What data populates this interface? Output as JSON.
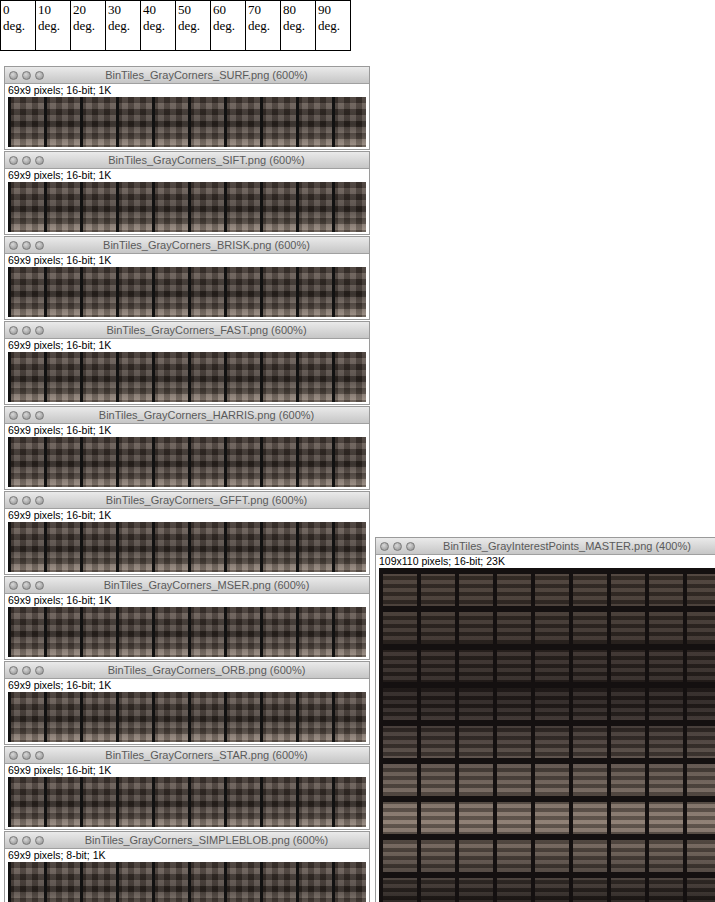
{
  "degrees": [
    {
      "label": "0 deg."
    },
    {
      "label": "10 deg."
    },
    {
      "label": "20 deg."
    },
    {
      "label": "30 deg."
    },
    {
      "label": "40 deg."
    },
    {
      "label": "50 deg."
    },
    {
      "label": "60 deg."
    },
    {
      "label": "70 deg."
    },
    {
      "label": "80 deg."
    },
    {
      "label": "90 deg."
    }
  ],
  "windows": [
    {
      "title": "BinTiles_GrayCorners_SURF.png (600%)",
      "info": "69x9 pixels; 16-bit; 1K"
    },
    {
      "title": "BinTiles_GrayCorners_SIFT.png (600%)",
      "info": "69x9 pixels; 16-bit; 1K"
    },
    {
      "title": "BinTiles_GrayCorners_BRISK.png (600%)",
      "info": "69x9 pixels; 16-bit; 1K"
    },
    {
      "title": "BinTiles_GrayCorners_FAST.png (600%)",
      "info": "69x9 pixels; 16-bit; 1K"
    },
    {
      "title": "BinTiles_GrayCorners_HARRIS.png (600%)",
      "info": "69x9 pixels; 16-bit; 1K"
    },
    {
      "title": "BinTiles_GrayCorners_GFFT.png (600%)",
      "info": "69x9 pixels; 16-bit; 1K"
    },
    {
      "title": "BinTiles_GrayCorners_MSER.png (600%)",
      "info": "69x9 pixels; 16-bit; 1K"
    },
    {
      "title": "BinTiles_GrayCorners_ORB.png (600%)",
      "info": "69x9 pixels; 16-bit; 1K"
    },
    {
      "title": "BinTiles_GrayCorners_STAR.png (600%)",
      "info": "69x9 pixels; 16-bit; 1K"
    },
    {
      "title": "BinTiles_GrayCorners_SIMPLEBLOB.png (600%)",
      "info": "69x9 pixels; 8-bit; 1K"
    }
  ],
  "master": {
    "title": "BinTiles_GrayInterestPoints_MASTER.png (400%)",
    "info": "109x110 pixels; 16-bit; 23K"
  }
}
